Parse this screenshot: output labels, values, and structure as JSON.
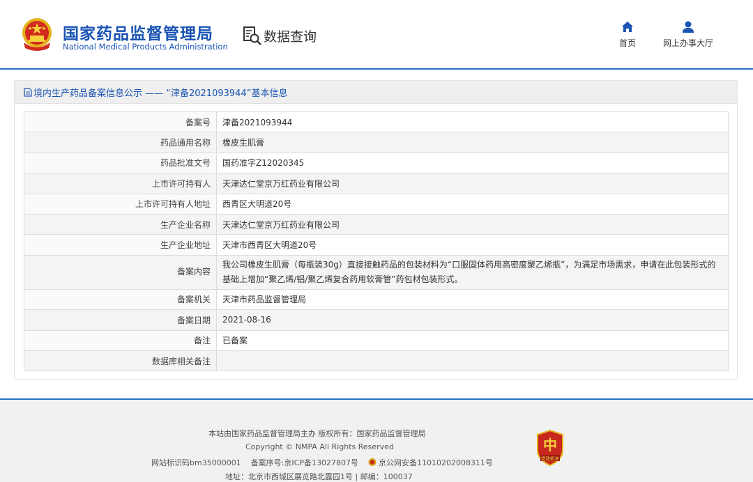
{
  "header": {
    "brand_cn": "国家药品监督管理局",
    "brand_en": "National Medical Products Administration",
    "section_title": "数据查询",
    "nav": [
      {
        "label": "首页",
        "icon": "home-icon"
      },
      {
        "label": "网上办事大厅",
        "icon": "user-icon"
      }
    ]
  },
  "panel": {
    "title": "境内生产药品备案信息公示 —— “津备2021093944”基本信息",
    "rows": [
      {
        "label": "备案号",
        "value": "津备2021093944"
      },
      {
        "label": "药品通用名称",
        "value": "橡皮生肌膏"
      },
      {
        "label": "药品批准文号",
        "value": "国药准字Z12020345"
      },
      {
        "label": "上市许可持有人",
        "value": "天津达仁堂京万红药业有限公司"
      },
      {
        "label": "上市许可持有人地址",
        "value": "西青区大明道20号"
      },
      {
        "label": "生产企业名称",
        "value": "天津达仁堂京万红药业有限公司"
      },
      {
        "label": "生产企业地址",
        "value": "天津市西青区大明道20号"
      },
      {
        "label": "备案内容",
        "value": "我公司橡皮生肌膏（每瓶装30g）直接接触药品的包装材料为“口服固体药用高密度聚乙烯瓶”，为满足市场需求，申请在此包装形式的基础上增加“聚乙烯/铝/聚乙烯复合药用软膏管”药包材包装形式。"
      },
      {
        "label": "备案机关",
        "value": "天津市药品监督管理局"
      },
      {
        "label": "备案日期",
        "value": "2021-08-16"
      },
      {
        "label": "备注",
        "value": "已备案"
      },
      {
        "label": "数据库相关备注",
        "value": ""
      }
    ]
  },
  "footer": {
    "line1": "本站由国家药品监督管理局主办 版权所有：国家药品监督管理局",
    "line2": "Copyright © NMPA All Rights Reserved",
    "site_id": "网站标识码bm35000001",
    "icp": "备案序号:京ICP备13027807号",
    "police": "京公网安备11010202008311号",
    "address": "地址：北京市西城区展览路北露园1号 | 邮编：100037",
    "badge_text": "党政机关"
  },
  "colors": {
    "brand_blue": "#1a54b4",
    "header_rule": "#2b6fc2",
    "badge_red": "#c8281e"
  }
}
